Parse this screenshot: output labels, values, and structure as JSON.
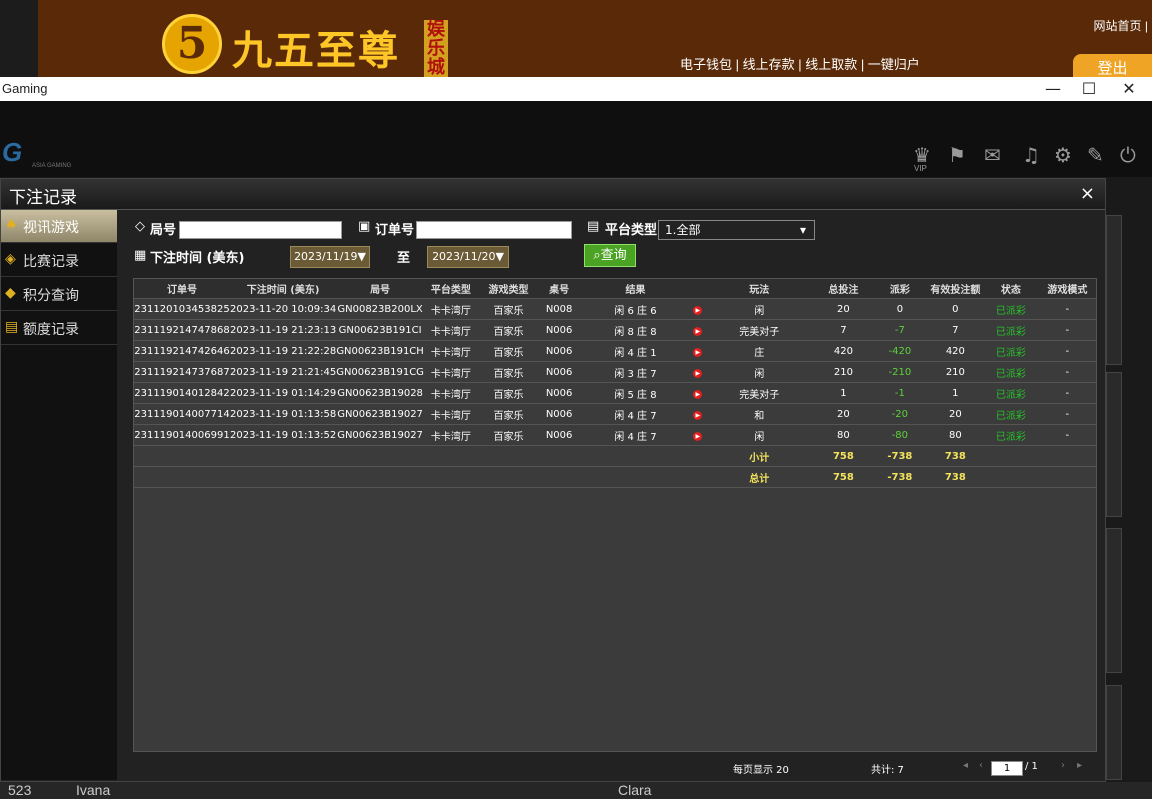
{
  "banner": {
    "title": "九五至尊",
    "logo_digit": "5",
    "sub": "娱乐城",
    "links": "电子钱包 | 线上存款 | 线上取款 | 一键归户",
    "home_link": "网站首页 |",
    "logout": "登出"
  },
  "window": {
    "title": "Gaming",
    "minimize": "—",
    "maximize": "☐",
    "close": "✕"
  },
  "game_header": {
    "logo": "G",
    "logo_sub": "ASIA GAMING",
    "vip": "VIP"
  },
  "modal": {
    "title": "下注记录",
    "close": "×",
    "sidebar": [
      {
        "label": "视讯游戏",
        "icon": "cards-icon"
      },
      {
        "label": "比赛记录",
        "icon": "tag-icon"
      },
      {
        "label": "积分查询",
        "icon": "diamond-icon"
      },
      {
        "label": "额度记录",
        "icon": "document-icon"
      }
    ],
    "filters": {
      "round_label": "局号",
      "order_label": "订单号",
      "platform_label": "平台类型",
      "platform_value": "1.全部",
      "time_label": "下注时间 (美东)",
      "date_from": "2023/11/19▼",
      "to_label": "至",
      "date_to": "2023/11/20▼",
      "query_button": "查询"
    },
    "table": {
      "headers": [
        "订单号",
        "下注时间 (美东)",
        "局号",
        "平台类型",
        "游戏类型",
        "桌号",
        "结果",
        "",
        "玩法",
        "总投注",
        "派彩",
        "有效投注额",
        "状态",
        "游戏模式"
      ],
      "rows": [
        [
          "231120103453825",
          "2023-11-20 10:09:34",
          "GN00823B200LX",
          "卡卡湾厅",
          "百家乐",
          "N008",
          "闲 6 庄 6",
          "闲",
          "20",
          "0",
          "0",
          "已派彩",
          "-"
        ],
        [
          "231119214747868",
          "2023-11-19 21:23:13",
          "GN00623B191CI",
          "卡卡湾厅",
          "百家乐",
          "N006",
          "闲 8 庄 8",
          "完美对子",
          "7",
          "-7",
          "7",
          "已派彩",
          "-"
        ],
        [
          "231119214742646",
          "2023-11-19 21:22:28",
          "GN00623B191CH",
          "卡卡湾厅",
          "百家乐",
          "N006",
          "闲 4 庄 1",
          "庄",
          "420",
          "-420",
          "420",
          "已派彩",
          "-"
        ],
        [
          "231119214737687",
          "2023-11-19 21:21:45",
          "GN00623B191CG",
          "卡卡湾厅",
          "百家乐",
          "N006",
          "闲 3 庄 7",
          "闲",
          "210",
          "-210",
          "210",
          "已派彩",
          "-"
        ],
        [
          "231119014012842",
          "2023-11-19 01:14:29",
          "GN00623B19028",
          "卡卡湾厅",
          "百家乐",
          "N006",
          "闲 5 庄 8",
          "完美对子",
          "1",
          "-1",
          "1",
          "已派彩",
          "-"
        ],
        [
          "231119014007714",
          "2023-11-19 01:13:58",
          "GN00623B19027",
          "卡卡湾厅",
          "百家乐",
          "N006",
          "闲 4 庄 7",
          "和",
          "20",
          "-20",
          "20",
          "已派彩",
          "-"
        ],
        [
          "231119014006991",
          "2023-11-19 01:13:52",
          "GN00623B19027",
          "卡卡湾厅",
          "百家乐",
          "N006",
          "闲 4 庄 7",
          "闲",
          "80",
          "-80",
          "80",
          "已派彩",
          "-"
        ]
      ],
      "subtotal": {
        "label": "小计",
        "bet": "758",
        "payout": "-738",
        "valid": "738"
      },
      "total": {
        "label": "总计",
        "bet": "758",
        "payout": "-738",
        "valid": "738"
      }
    },
    "pager": {
      "per_page": "每页显示 20",
      "total": "共计: 7",
      "current": "1",
      "slash_total": "/ 1"
    }
  },
  "bottom": {
    "names": [
      "523",
      "Ivana",
      "Clara"
    ]
  }
}
